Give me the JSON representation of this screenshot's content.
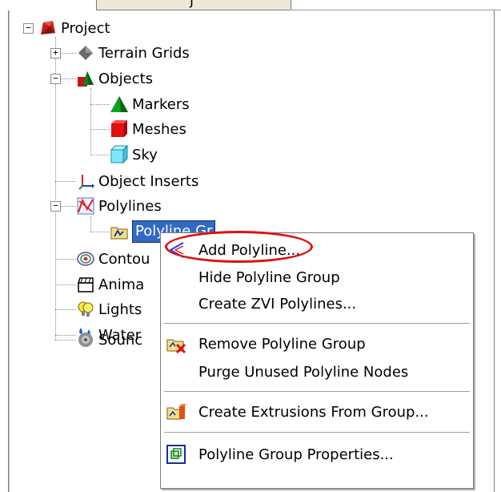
{
  "tree": {
    "nodes": [
      {
        "label": "Project",
        "icon": "project-icon",
        "expander": "−"
      },
      {
        "label": "Terrain Grids",
        "icon": "terrain-grids-icon",
        "expander": "+"
      },
      {
        "label": "Objects",
        "icon": "objects-icon",
        "expander": "−"
      },
      {
        "label": "Markers",
        "icon": "markers-icon"
      },
      {
        "label": "Meshes",
        "icon": "meshes-icon"
      },
      {
        "label": "Sky",
        "icon": "sky-icon"
      },
      {
        "label": "Object Inserts",
        "icon": "object-inserts-icon"
      },
      {
        "label": "Polylines",
        "icon": "polylines-icon",
        "expander": "−"
      },
      {
        "label": "Polyline Gr",
        "icon": "polyline-group-folder-icon",
        "selected": true
      },
      {
        "label": "Contou",
        "icon": "contours-icon"
      },
      {
        "label": "Anima",
        "icon": "animation-icon"
      },
      {
        "label": "Lights",
        "icon": "lights-icon"
      },
      {
        "label": "Water",
        "icon": "water-icon"
      },
      {
        "label": "Sounc",
        "icon": "sounds-icon"
      }
    ]
  },
  "context_menu": {
    "items": [
      {
        "label": "Add Polyline...",
        "icon": "add-polyline-icon",
        "highlighted_by_annotation": true
      },
      {
        "label": "Hide Polyline Group"
      },
      {
        "label": "Create ZVI Polylines..."
      },
      {
        "label": "Remove Polyline Group",
        "icon": "remove-polyline-group-icon"
      },
      {
        "label": "Purge Unused Polyline Nodes"
      },
      {
        "label": "Create Extrusions From Group...",
        "icon": "create-extrusions-icon"
      },
      {
        "label": "Polyline Group Properties...",
        "icon": "properties-icon"
      }
    ]
  },
  "colors": {
    "selection": "#316ac5",
    "annotation": "#e01010"
  }
}
